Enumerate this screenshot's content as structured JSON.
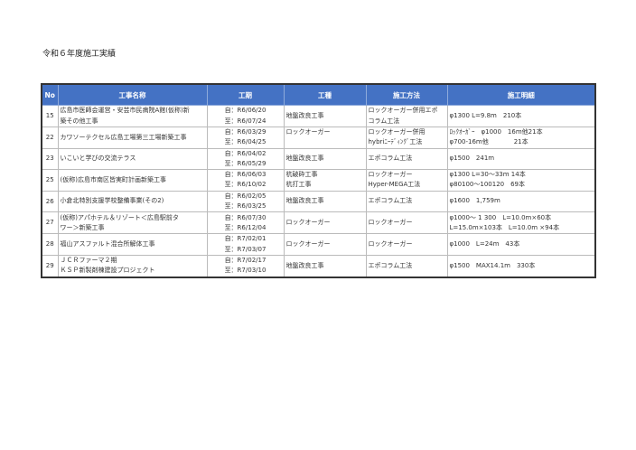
{
  "title": "令和６年度施工実績",
  "headers": [
    "No",
    "工事名称",
    "工期",
    "工種",
    "施工方法",
    "施工明細"
  ],
  "rows": [
    {
      "no": "15",
      "name": [
        "広島市医師会運営・安芸市民病院A館(仮称)新",
        "築その他工事"
      ],
      "period": [
        "自：R6/06/20",
        "至：R6/07/24"
      ],
      "type": [
        "地盤改良工事"
      ],
      "method": [
        "ロックオーガー併用エポ",
        "コラム工法"
      ],
      "detail": [
        "φ1300 L=9.8m　210本"
      ]
    },
    {
      "no": "22",
      "name": [
        "カワソーテクセル広島工場第三工場新築工事"
      ],
      "period": [
        "自：R6/03/29",
        "至：R6/04/25"
      ],
      "type": [
        "ロックオーガー",
        ""
      ],
      "method": [
        "ロックオーガー併用",
        "hybriﾆｰﾃﾞｨﾝｸﾞ工法"
      ],
      "detail": [
        "ﾛｯｸｵｰｶﾞｰ　φ1000　16m他21本",
        "φ700-16m他　　　　21本"
      ]
    },
    {
      "no": "23",
      "name": [
        "いこいと学びの交流テラス"
      ],
      "period": [
        "自：R6/04/02",
        "至：R6/05/29"
      ],
      "type": [
        "地盤改良工事"
      ],
      "method": [
        "エポコラム工法"
      ],
      "detail": [
        "φ1500　241m"
      ]
    },
    {
      "no": "25",
      "name": [
        "(仮称)広島市南区皆実町計画新築工事"
      ],
      "period": [
        "自：R6/06/03",
        "至：R6/10/02"
      ],
      "type": [
        "杭破砕工事",
        "杭打工事"
      ],
      "method": [
        "ロックオーガー",
        "Hyper-MEGA工法"
      ],
      "detail": [
        "φ1300 L=30～33m 14本",
        "φ80100～100120　69本"
      ]
    },
    {
      "no": "26",
      "name": [
        "小倉北特別支援学校整備事業(その2)"
      ],
      "period": [
        "自：R6/02/05",
        "至：R6/03/25"
      ],
      "type": [
        "地盤改良工事"
      ],
      "method": [
        "エポコラム工法"
      ],
      "detail": [
        "φ1600　1,759m"
      ]
    },
    {
      "no": "27",
      "name": [
        "(仮称)アパホテル＆リゾート＜広島駅前タ",
        "ワー＞新築工事"
      ],
      "period": [
        "自：R6/07/30",
        "至：R6/12/04"
      ],
      "type": [
        "ロックオーガー"
      ],
      "method": [
        "ロックオーガー"
      ],
      "detail": [
        "φ1000～ 1 300　L=10.0m×60本",
        "L=15.0m×103本　L=10.0m ×94本"
      ]
    },
    {
      "no": "28",
      "name": [
        "福山アスファルト混合所解体工事"
      ],
      "period": [
        "自：R7/02/01",
        "至：R7/03/07"
      ],
      "type": [
        "ロックオーガー"
      ],
      "method": [
        "ロックオーガー"
      ],
      "detail": [
        "φ1000　L=24m　43本"
      ]
    },
    {
      "no": "29",
      "name": [
        "ＪＣＲファーマ２期",
        "ＫＳＰ新製剤棟建設プロジェクト"
      ],
      "period": [
        "自：R7/02/17",
        "至：R7/03/10"
      ],
      "type": [
        "地盤改良工事"
      ],
      "method": [
        "エポコラム工法"
      ],
      "detail": [
        "φ1500　MAX14.1m　330本"
      ]
    }
  ]
}
